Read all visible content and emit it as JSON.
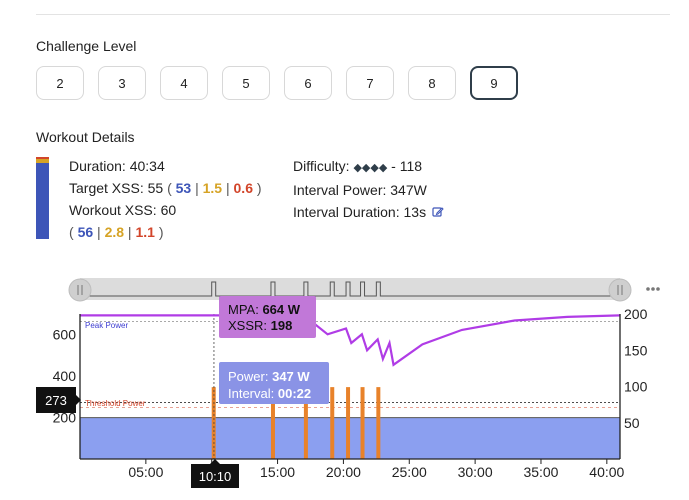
{
  "challenge": {
    "title": "Challenge Level",
    "levels": [
      "2",
      "3",
      "4",
      "5",
      "6",
      "7",
      "8",
      "9"
    ],
    "selected": "9"
  },
  "workout": {
    "title": "Workout Details",
    "duration_label": "Duration:",
    "duration_value": "40:34",
    "target_xss_label": "Target XSS:",
    "target_xss_value": "55",
    "target_xss_parts": [
      "53",
      "1.5",
      "0.6"
    ],
    "workout_xss_label": "Workout XSS:",
    "workout_xss_value": "60",
    "workout_xss_parts": [
      "56",
      "2.8",
      "1.1"
    ],
    "difficulty_label": "Difficulty:",
    "difficulty_diamonds": "◆◆◆◆",
    "difficulty_value": "- 118",
    "interval_power_label": "Interval Power:",
    "interval_power_value": "347W",
    "interval_duration_label": "Interval Duration:",
    "interval_duration_value": "13s",
    "edit_icon": "edit-icon"
  },
  "colors": {
    "blue": "#3d55b8",
    "yellow": "#d6a325",
    "red": "#d2452a",
    "purple": "#b03ce6",
    "power_fill": "#8b9ff0",
    "interval": "#e8822a",
    "tooltip_mpa": "#c178d8",
    "tooltip_power": "#8a93e6",
    "peak_power_text": "#3d3dd1",
    "threshold_text": "#d2452a"
  },
  "chart": {
    "more_icon": "more-horizontal-icon",
    "peak_power_label": "Peak Power",
    "threshold_power_label": "Threshold Power",
    "y_marker": "273",
    "x_marker": "10:10",
    "tooltip_mpa": {
      "mpa_label": "MPA:",
      "mpa_value": "664 W",
      "xssr_label": "XSSR:",
      "xssr_value": "198"
    },
    "tooltip_power": {
      "power_label": "Power:",
      "power_value": "347 W",
      "interval_label": "Interval:",
      "interval_value": "00:22"
    }
  },
  "chart_data": {
    "type": "area",
    "x_unit": "minutes",
    "xlim": [
      0,
      41
    ],
    "x_ticks": [
      "05:00",
      "10:00",
      "15:00",
      "20:00",
      "25:00",
      "30:00",
      "35:00",
      "40:00"
    ],
    "y_left_ticks": [
      "600",
      "400",
      "200"
    ],
    "y_left_lim": [
      0,
      700
    ],
    "y_right_ticks": [
      "200",
      "150",
      "100",
      "50"
    ],
    "y_right_lim": [
      0,
      200
    ],
    "threshold_power": 273,
    "peak_power": 664,
    "base_power": 200,
    "interval_power": 347,
    "interval_starts_min": [
      10.0,
      14.5,
      17.0,
      19.0,
      20.2,
      21.3,
      22.5
    ],
    "interval_duration_s": 13,
    "xssr_series": [
      {
        "x": 0,
        "y": 198
      },
      {
        "x": 10,
        "y": 198
      },
      {
        "x": 17,
        "y": 198
      },
      {
        "x": 18.8,
        "y": 172
      },
      {
        "x": 20.2,
        "y": 180
      },
      {
        "x": 20.6,
        "y": 160
      },
      {
        "x": 21.4,
        "y": 172
      },
      {
        "x": 21.8,
        "y": 150
      },
      {
        "x": 22.6,
        "y": 165
      },
      {
        "x": 23.0,
        "y": 138
      },
      {
        "x": 23.5,
        "y": 160
      },
      {
        "x": 23.8,
        "y": 130
      },
      {
        "x": 26,
        "y": 158
      },
      {
        "x": 29,
        "y": 178
      },
      {
        "x": 33,
        "y": 191
      },
      {
        "x": 37,
        "y": 196
      },
      {
        "x": 41,
        "y": 198
      }
    ]
  }
}
